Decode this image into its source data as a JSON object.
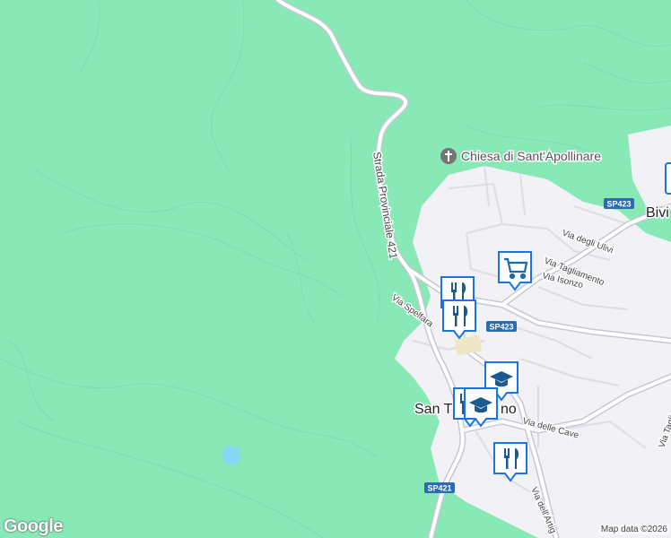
{
  "map": {
    "background_color": "#88e8b6",
    "urban_color": "#f2f1f6",
    "road_color": "#ffffff",
    "road_casing_color": "#c5c8d6",
    "shield_color": "#2b6cb0",
    "marker_color": "#1a73e8"
  },
  "labels": {
    "church": "Chiesa di Sant'Apollinare",
    "strada_provinciale": "Strada Provinciale 421",
    "via_spelfara": "Via Spelfara",
    "via_ulivi": "Via degli Ulivi",
    "via_tagliamento": "Via Tagliamento",
    "via_isonzo": "Via Isonzo",
    "via_cave": "Via delle Cave",
    "via_artigiani": "Via dell'Artig",
    "via_tagli_right": "Via Tagli",
    "town_main": "San T",
    "town_main_end": "no",
    "town_right": "Bivi"
  },
  "shields": {
    "sp423_top": "SP423",
    "sp423_mid": "SP423",
    "sp421": "SP421"
  },
  "markers": [
    {
      "name": "supermarket-marker",
      "icon": "shopping-cart-icon"
    },
    {
      "name": "restaurant-marker-1",
      "icon": "fork-knife-icon"
    },
    {
      "name": "restaurant-marker-2",
      "icon": "fork-knife-icon"
    },
    {
      "name": "school-marker-1",
      "icon": "graduation-cap-icon"
    },
    {
      "name": "school-marker-2",
      "icon": "graduation-cap-icon"
    },
    {
      "name": "restaurant-marker-3",
      "icon": "fork-knife-icon"
    },
    {
      "name": "restaurant-marker-4",
      "icon": "fork-knife-icon"
    }
  ],
  "footer": {
    "logo": "Google",
    "attribution": "Map data ©2026"
  }
}
